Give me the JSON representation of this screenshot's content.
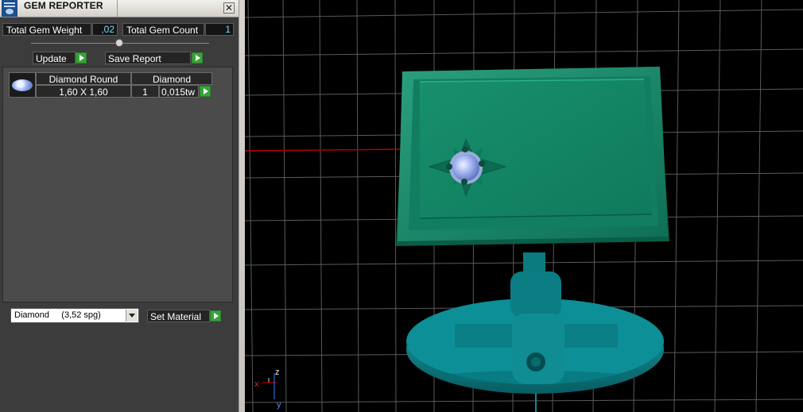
{
  "window": {
    "title": "GEM REPORTER",
    "close_symbol": "✕"
  },
  "summary": {
    "total_weight_label": "Total Gem Weight",
    "total_weight_value": ",02",
    "total_count_label": "Total Gem Count",
    "total_count_value": "1"
  },
  "buttons": {
    "update": "Update",
    "save_report": "Save Report",
    "set_material": "Set Material"
  },
  "gem_list": {
    "headers": [
      "Diamond Round",
      "Diamond"
    ],
    "rows": [
      {
        "size": "1,60 X 1,60",
        "count": "1",
        "weight": "0,015tw"
      }
    ]
  },
  "material_select": {
    "selected": "Diamond     (3,52 spg)"
  },
  "viewport": {
    "axis_labels": {
      "x": "x",
      "y": "y",
      "z": "z"
    },
    "colors": {
      "background": "#000000",
      "grid": "#5a5a5a",
      "model": "#0f8a6c",
      "base": "#0a7f86",
      "gem": "#8fa6f2",
      "axis_x": "#b10000"
    }
  },
  "icons": [
    "gem-reporter-app-icon",
    "close-icon",
    "go-arrow-icon",
    "gem-thumbnail-icon",
    "chevron-down-icon"
  ]
}
